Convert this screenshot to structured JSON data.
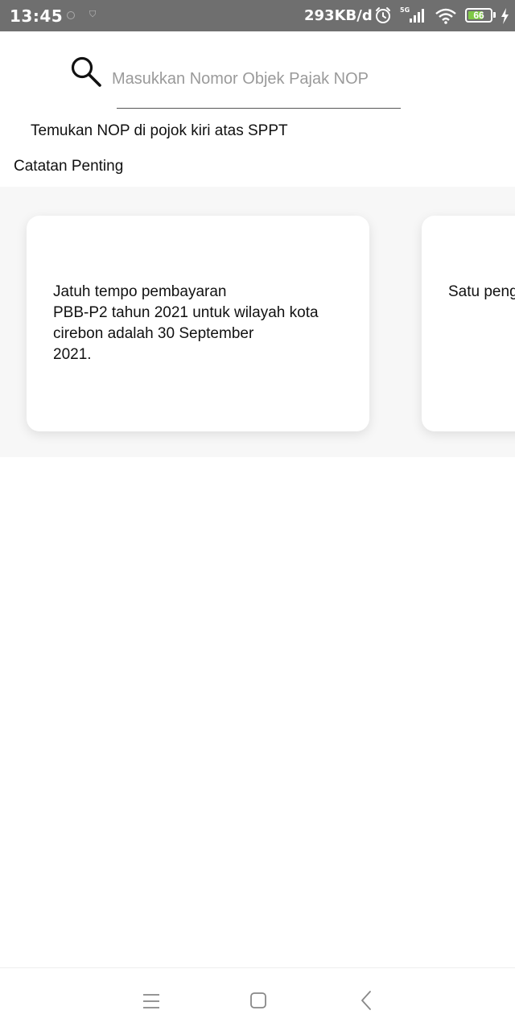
{
  "status_bar": {
    "time": "13:45",
    "network_speed": "293KB/d",
    "network_type": "5G",
    "battery_level": "66",
    "icons": [
      "settings-dot-icon",
      "shield-icon",
      "alarm-icon",
      "signal-icon",
      "wifi-icon",
      "battery-icon",
      "charging-icon"
    ]
  },
  "search": {
    "placeholder": "Masukkan Nomor Objek Pajak NOP",
    "value": ""
  },
  "hint": "Temukan NOP di pojok kiri atas SPPT",
  "notes_title": "Catatan Penting",
  "cards": [
    {
      "text": "Jatuh tempo pembayaran\nPBB-P2 tahun 2021 untuk wilayah kota\ncirebon adalah 30 September\n2021."
    },
    {
      "text": "Satu peng\npembaya\natas nam"
    }
  ],
  "nav_bar": {
    "icons": [
      "menu-icon",
      "home-icon",
      "back-icon"
    ]
  },
  "colors": {
    "status_bar_bg": "#6f6f6f",
    "battery_fill": "#7ec845",
    "page_bg": "#ffffff",
    "strip_bg": "#f7f7f7",
    "placeholder": "#9a9a9a"
  }
}
